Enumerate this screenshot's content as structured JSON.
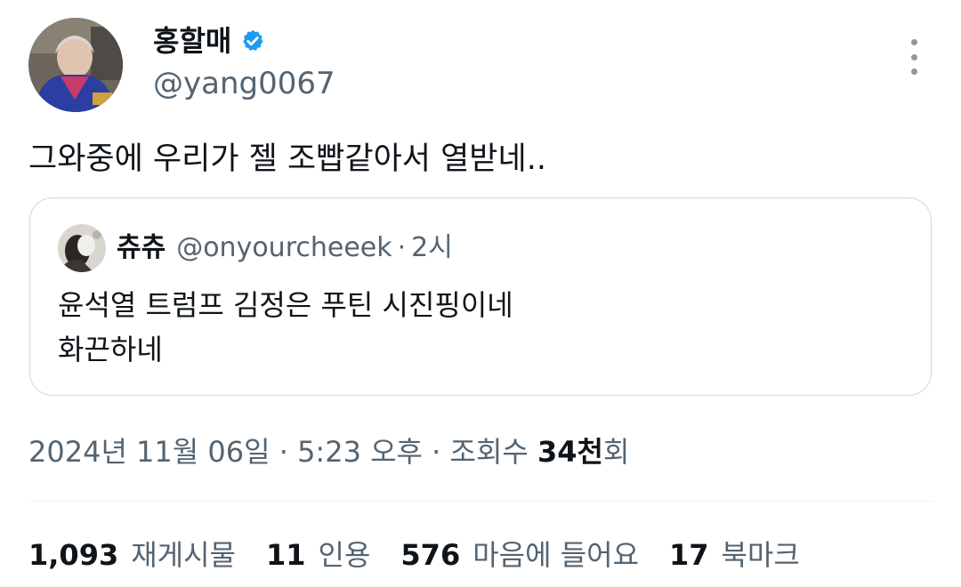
{
  "tweet": {
    "author": {
      "name": "홍할매",
      "handle": "@yang0067",
      "verified": true
    },
    "text": "그와중에 우리가 젤 조빱같아서 열받네..",
    "quote": {
      "name": "츄츄",
      "handle": "@onyourcheeek",
      "separator": "·",
      "time": "2시",
      "lines": [
        "윤석열 트럼프 김정은 푸틴 시진핑이네",
        "화끈하네"
      ]
    },
    "meta": {
      "date": "2024년 11월 06일",
      "sep1": "·",
      "time": "5:23 오후",
      "sep2": "·",
      "views_label": "조회수",
      "views_count": "34천",
      "views_suffix": "회"
    },
    "stats": {
      "reposts": {
        "count": "1,093",
        "label": "재게시물"
      },
      "quotes": {
        "count": "11",
        "label": "인용"
      },
      "likes": {
        "count": "576",
        "label": "마음에 들어요"
      },
      "bookmarks": {
        "count": "17",
        "label": "북마크"
      }
    }
  },
  "colors": {
    "text_primary": "#0f1419",
    "text_secondary": "#536471",
    "border": "#cfd9de",
    "verified_blue": "#1d9bf0"
  },
  "icons": {
    "verified": "verified-badge-icon",
    "more": "more-dots-icon"
  }
}
